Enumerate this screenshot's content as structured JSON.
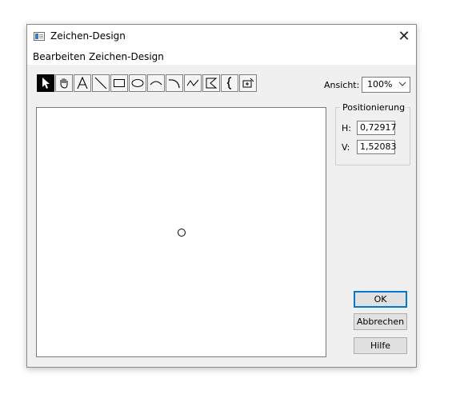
{
  "window": {
    "title": "Zeichen-Design",
    "close_glyph": "✕"
  },
  "menu": {
    "items": [
      {
        "label": "Bearbeiten"
      },
      {
        "label": "Zeichen-Design"
      }
    ]
  },
  "toolbar": {
    "tools": [
      {
        "icon": "arrow-pointer-icon",
        "selected": true
      },
      {
        "icon": "hand-icon"
      },
      {
        "icon": "text-icon",
        "glyph": "A"
      },
      {
        "icon": "line-icon"
      },
      {
        "icon": "rectangle-icon"
      },
      {
        "icon": "ellipse-icon"
      },
      {
        "icon": "arc-icon"
      },
      {
        "icon": "quarter-arc-icon"
      },
      {
        "icon": "freehand-icon"
      },
      {
        "icon": "polygon-icon"
      },
      {
        "icon": "brace-icon",
        "glyph": "{"
      },
      {
        "icon": "symbol-icon"
      }
    ]
  },
  "zoom": {
    "label": "Ansicht:",
    "value": "100%"
  },
  "positioning": {
    "legend": "Positionierung",
    "h_label": "H:",
    "h_value": "0,72917",
    "v_label": "V:",
    "v_value": "1,52083"
  },
  "buttons": {
    "ok": "OK",
    "cancel": "Abbrechen",
    "help": "Hilfe"
  }
}
